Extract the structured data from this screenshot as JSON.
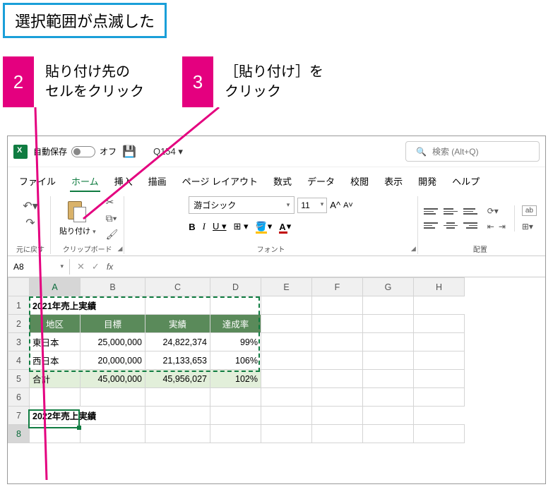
{
  "callouts": {
    "top": "選択範囲が点滅した",
    "c2": {
      "num": "2",
      "text": "貼り付け先の\nセルをクリック"
    },
    "c3": {
      "num": "3",
      "text": "［貼り付け］を\nクリック"
    }
  },
  "titlebar": {
    "autosave_label": "自動保存",
    "autosave_state": "オフ",
    "filename": "Q154 ▾",
    "search_placeholder": "検索 (Alt+Q)"
  },
  "tabs": [
    "ファイル",
    "ホーム",
    "挿入",
    "描画",
    "ページ レイアウト",
    "数式",
    "データ",
    "校閲",
    "表示",
    "開発",
    "ヘルプ"
  ],
  "active_tab": 1,
  "ribbon": {
    "undo_label": "元に戻す",
    "paste_label": "貼り付け",
    "clipboard_label": "クリップボード",
    "font_name": "游ゴシック",
    "font_size": "11",
    "font_label": "フォント",
    "align_label": "配置",
    "wrap_label": "ab"
  },
  "namebox": "A8",
  "fx": "fx",
  "columns": [
    "A",
    "B",
    "C",
    "D",
    "E",
    "F",
    "G",
    "H"
  ],
  "rows": [
    "1",
    "2",
    "3",
    "4",
    "5",
    "6",
    "7",
    "8"
  ],
  "sheet": {
    "title1": "2021年売上実績",
    "headers": [
      "地区",
      "目標",
      "実績",
      "達成率"
    ],
    "data": [
      {
        "region": "東日本",
        "target": "25,000,000",
        "actual": "24,822,374",
        "rate": "99%"
      },
      {
        "region": "西日本",
        "target": "20,000,000",
        "actual": "21,133,653",
        "rate": "106%"
      }
    ],
    "total": {
      "label": "合計",
      "target": "45,000,000",
      "actual": "45,956,027",
      "rate": "102%"
    },
    "title2": "2022年売上実績"
  },
  "chart_data": {
    "type": "table",
    "title": "2021年売上実績",
    "columns": [
      "地区",
      "目標",
      "実績",
      "達成率"
    ],
    "rows": [
      [
        "東日本",
        25000000,
        24822374,
        0.99
      ],
      [
        "西日本",
        20000000,
        21133653,
        1.06
      ],
      [
        "合計",
        45000000,
        45956027,
        1.02
      ]
    ]
  }
}
